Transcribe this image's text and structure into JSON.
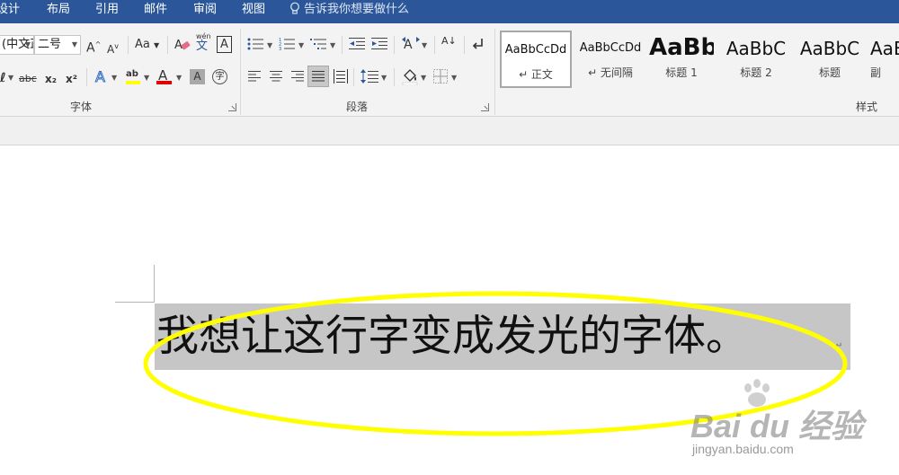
{
  "menu": {
    "tabs": [
      "设计",
      "布局",
      "引用",
      "邮件",
      "审阅",
      "视图"
    ],
    "tell_me": "告诉我你想要做什么"
  },
  "font_group": {
    "font_name": "(中文正文",
    "font_size": "二号",
    "grow_label": "A",
    "shrink_label": "A",
    "case_label": "Aa",
    "pinyin_label": "wén",
    "pinyin_char": "文",
    "border_char_label": "A",
    "strike_label": "abc",
    "sub_label": "x₂",
    "sup_label": "x²",
    "effect_label": "A",
    "highlight_label": "ab",
    "color_label": "A",
    "shade_label": "A",
    "enclose_label": "字",
    "label": "字体"
  },
  "paragraph_group": {
    "label": "段落",
    "sort_label": "A↓"
  },
  "styles_group": {
    "label": "样式",
    "items": [
      {
        "preview": "AaBbCcDd",
        "name": "↵ 正文"
      },
      {
        "preview": "AaBbCcDd",
        "name": "↵ 无间隔"
      },
      {
        "preview": "AaBb",
        "name": "标题 1"
      },
      {
        "preview": "AaBbC",
        "name": "标题 2"
      },
      {
        "preview": "AaBbC",
        "name": "标题"
      },
      {
        "preview": "AaB",
        "name": "副"
      }
    ]
  },
  "document": {
    "text": "我想让这行字变成发光的字体。",
    "para_mark": "↵"
  },
  "watermark": {
    "brand": "Bai du 经验",
    "site": "jingyan.baidu.com"
  },
  "colors": {
    "title_bar": "#2b579a",
    "highlight_yellow": "#ffff00",
    "font_color_red": "#e00000",
    "selection_gray": "#c6c6c6",
    "annotation_yellow": "#ffff00"
  }
}
